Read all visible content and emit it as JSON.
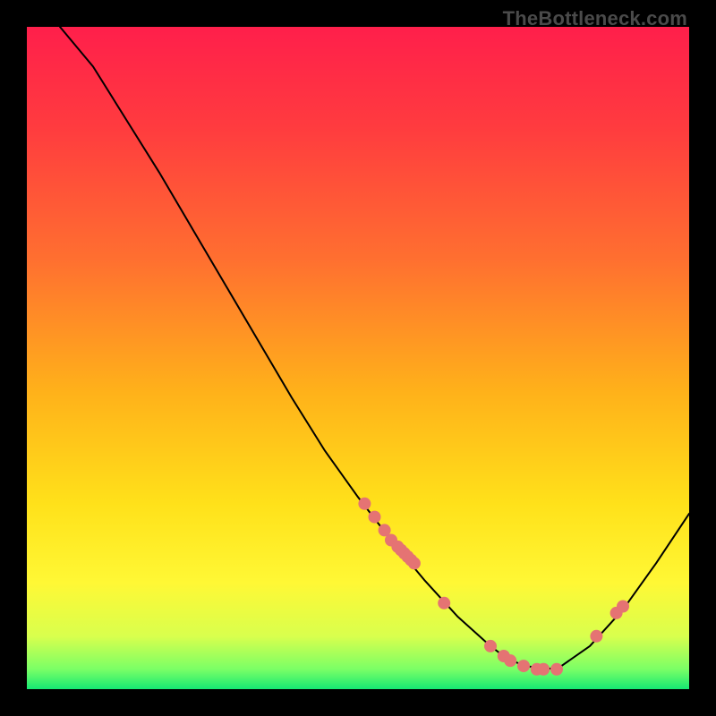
{
  "watermark": "TheBottleneck.com",
  "chart_data": {
    "type": "line",
    "title": "",
    "xlabel": "",
    "ylabel": "",
    "xlim": [
      0,
      100
    ],
    "ylim": [
      0,
      100
    ],
    "grid": false,
    "series": [
      {
        "name": "curve",
        "type": "line",
        "stroke": "#000000",
        "x": [
          5,
          10,
          15,
          20,
          25,
          30,
          35,
          40,
          45,
          50,
          55,
          60,
          65,
          70,
          72,
          75,
          80,
          85,
          90,
          95,
          100
        ],
        "y": [
          100,
          94,
          86,
          78,
          69.5,
          61,
          52.5,
          44,
          36,
          29,
          22.5,
          16.5,
          11,
          6.5,
          5,
          3.5,
          3,
          6.5,
          12,
          19,
          26.5
        ]
      },
      {
        "name": "points",
        "type": "scatter",
        "fill": "#e57373",
        "x": [
          51,
          52.5,
          54,
          55,
          56,
          56.5,
          57,
          57.5,
          58,
          58.5,
          63,
          70,
          72,
          73,
          75,
          77,
          78,
          80,
          86,
          89,
          90
        ],
        "y": [
          28,
          26,
          24,
          22.5,
          21.5,
          21,
          20.5,
          20,
          19.5,
          19,
          13,
          6.5,
          5,
          4.3,
          3.5,
          3,
          3,
          3,
          8,
          11.5,
          12.5
        ]
      }
    ],
    "background_gradient": {
      "stops": [
        {
          "offset": 0.0,
          "color": "#ff1f4b"
        },
        {
          "offset": 0.15,
          "color": "#ff3b3f"
        },
        {
          "offset": 0.35,
          "color": "#ff6f30"
        },
        {
          "offset": 0.55,
          "color": "#ffb11a"
        },
        {
          "offset": 0.72,
          "color": "#ffe11a"
        },
        {
          "offset": 0.84,
          "color": "#fff835"
        },
        {
          "offset": 0.92,
          "color": "#d9ff4d"
        },
        {
          "offset": 0.97,
          "color": "#7aff66"
        },
        {
          "offset": 1.0,
          "color": "#16e873"
        }
      ]
    },
    "colors": {
      "curve": "#000000",
      "point_fill": "#e57373",
      "point_stroke": "#c85a5a"
    }
  }
}
